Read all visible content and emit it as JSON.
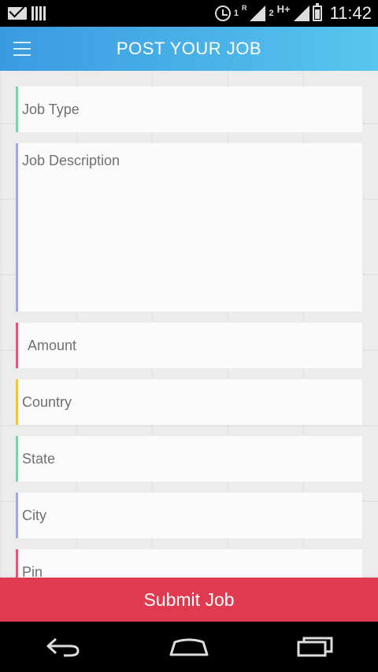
{
  "status_bar": {
    "sim1_label": "1",
    "roaming_label": "R",
    "sim2_label": "2",
    "network_label": "H+",
    "time": "11:42"
  },
  "app_bar": {
    "title": "POST YOUR JOB",
    "menu_icon": "hamburger-menu-icon"
  },
  "form": {
    "job_type_placeholder": "Job Type",
    "job_description_placeholder": "Job Description",
    "amount_placeholder": "Amount",
    "country_placeholder": "Country",
    "state_placeholder": "State",
    "city_placeholder": "City",
    "pin_placeholder": "Pin"
  },
  "submit_label": "Submit Job",
  "colors": {
    "app_bar_start": "#3a9be0",
    "app_bar_end": "#58c6ee",
    "submit_bg": "#e03a50",
    "accent_green": "#7fd0a8",
    "accent_purple": "#9fa8e0",
    "accent_red": "#e05a78",
    "accent_yellow": "#f2c14a"
  },
  "nav_bar": {
    "back_icon": "back-icon",
    "home_icon": "home-icon",
    "recents_icon": "recents-icon"
  }
}
